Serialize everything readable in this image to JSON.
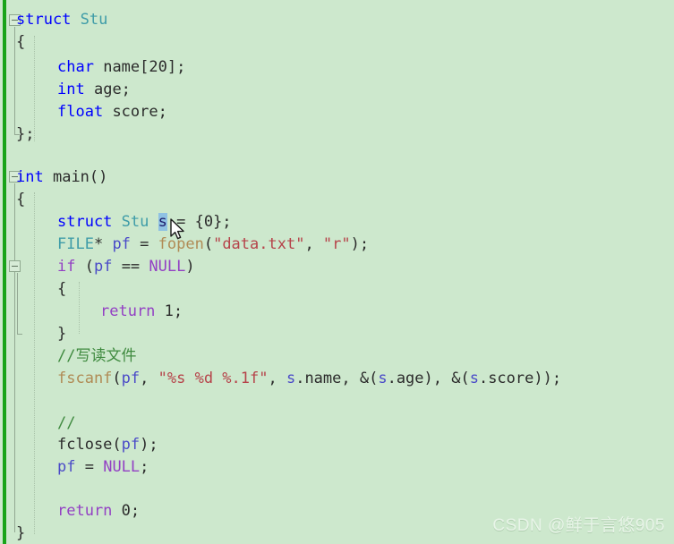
{
  "editor": {
    "background_color": "#cde8cd",
    "change_bar_color": "#19a319",
    "selection_color": "#8fc1e3",
    "font_size_px": 17,
    "line_height_px": 25
  },
  "colors": {
    "keyword": "#0000ff",
    "type": "#3f9ca8",
    "control": "#9340c4",
    "function": "#b08b55",
    "string": "#b6434a",
    "comment": "#3f8a3f",
    "plain": "#2b2b2b"
  },
  "code_lines": [
    {
      "n": 1,
      "indent": 0,
      "text": "struct Stu"
    },
    {
      "n": 2,
      "indent": 0,
      "text": "{"
    },
    {
      "n": 3,
      "indent": 1,
      "text": "char name[20];"
    },
    {
      "n": 4,
      "indent": 1,
      "text": "int age;"
    },
    {
      "n": 5,
      "indent": 1,
      "text": "float score;"
    },
    {
      "n": 6,
      "indent": 0,
      "text": "};"
    },
    {
      "n": 7,
      "indent": 0,
      "text": ""
    },
    {
      "n": 8,
      "indent": 0,
      "text": "int main()"
    },
    {
      "n": 9,
      "indent": 0,
      "text": "{"
    },
    {
      "n": 10,
      "indent": 1,
      "text": "struct Stu s = {0};"
    },
    {
      "n": 11,
      "indent": 1,
      "text": "FILE* pf = fopen(\"data.txt\", \"r\");"
    },
    {
      "n": 12,
      "indent": 1,
      "text": "if (pf == NULL)"
    },
    {
      "n": 13,
      "indent": 1,
      "text": "{"
    },
    {
      "n": 14,
      "indent": 2,
      "text": "return 1;"
    },
    {
      "n": 15,
      "indent": 1,
      "text": "}"
    },
    {
      "n": 16,
      "indent": 1,
      "text": "//写读文件"
    },
    {
      "n": 17,
      "indent": 1,
      "text": "fscanf(pf, \"%s %d %.1f\", s.name, &(s.age), &(s.score));"
    },
    {
      "n": 18,
      "indent": 1,
      "text": ""
    },
    {
      "n": 19,
      "indent": 1,
      "text": "//"
    },
    {
      "n": 20,
      "indent": 1,
      "text": "fclose(pf);"
    },
    {
      "n": 21,
      "indent": 1,
      "text": "pf = NULL;"
    },
    {
      "n": 22,
      "indent": 1,
      "text": ""
    },
    {
      "n": 23,
      "indent": 1,
      "text": "return 0;"
    },
    {
      "n": 24,
      "indent": 0,
      "text": "}"
    }
  ],
  "tokens": {
    "l1": {
      "kw": "struct",
      "type": "Stu"
    },
    "l2": {
      "brace": "{"
    },
    "l3": {
      "kw": "char",
      "rest": "name[20];"
    },
    "l4": {
      "kw": "int",
      "rest": "age;"
    },
    "l5": {
      "kw": "float",
      "rest": "score;"
    },
    "l6": {
      "brace": "};"
    },
    "l8": {
      "kw": "int",
      "rest": "main()"
    },
    "l9": {
      "brace": "{"
    },
    "l10": {
      "kw": "struct",
      "type": "Stu",
      "var": "s",
      "rest": " = {0};"
    },
    "l11": {
      "type": "FILE",
      "star": "* ",
      "var": "pf",
      "eq": " = ",
      "fn": "fopen",
      "p1": "(",
      "s1": "\"data.txt\"",
      "comma": ", ",
      "s2": "\"r\"",
      "p2": ");"
    },
    "l12": {
      "ctl": "if",
      "open": " (",
      "var": "pf",
      "op": " == ",
      "nul": "NULL",
      "close": ")"
    },
    "l13": {
      "brace": "{"
    },
    "l14": {
      "ctl": "return",
      "rest": " 1;"
    },
    "l15": {
      "brace": "}"
    },
    "l16": {
      "cmt": "//写读文件"
    },
    "l17": {
      "fn": "fscanf",
      "p1": "(",
      "var1": "pf",
      "c1": ", ",
      "fmt": "\"%s %d %.1f\"",
      "c2": ", ",
      "v2": "s",
      "m1": ".name, &(",
      "v3": "s",
      "m2": ".age), &(",
      "v4": "s",
      "m3": ".score));"
    },
    "l19": {
      "cmt": "//"
    },
    "l20": {
      "fn": "fclose",
      "p1": "(",
      "var": "pf",
      "p2": ");"
    },
    "l21": {
      "var": "pf",
      "eq": " = ",
      "nul": "NULL",
      "semi": ";"
    },
    "l23": {
      "ctl": "return",
      "rest": " 0;"
    },
    "l24": {
      "brace": "}"
    }
  },
  "selection": {
    "selected_text": "s",
    "line": 10
  },
  "fold_markers": [
    {
      "line": 1,
      "state": "expanded"
    },
    {
      "line": 8,
      "state": "expanded"
    },
    {
      "line": 12,
      "state": "expanded"
    }
  ],
  "watermark": {
    "text": "CSDN @鲜于言悠905"
  }
}
